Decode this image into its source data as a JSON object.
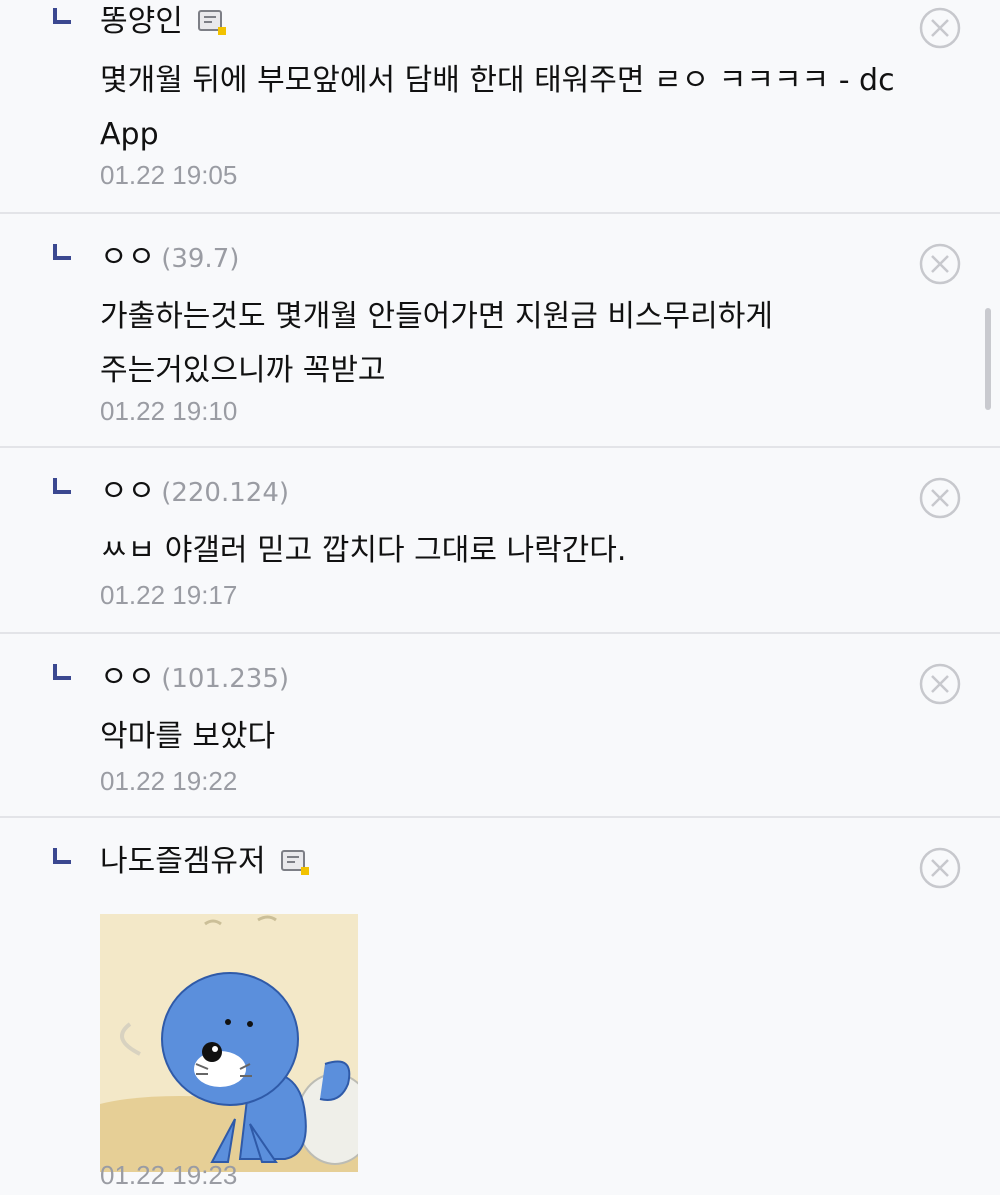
{
  "replies": [
    {
      "author": "똥양인",
      "ip": "",
      "has_fixed_icon": true,
      "content": "몇개월 뒤에 부모앞에서 담배 한대 태워주면 ㄹㅇ ㅋㅋㅋㅋ - dc App",
      "date": "01.22 19:05"
    },
    {
      "author": "ㅇㅇ",
      "ip": "(39.7)",
      "has_fixed_icon": false,
      "content": "가출하는것도 몇개월 안들어가면 지원금 비스무리하게 주는거있으니까 꼭받고",
      "date": "01.22 19:10"
    },
    {
      "author": "ㅇㅇ",
      "ip": "(220.124)",
      "has_fixed_icon": false,
      "content": "ㅆㅂ 야갤러 믿고 깝치다 그대로 나락간다.",
      "date": "01.22 19:17"
    },
    {
      "author": "ㅇㅇ",
      "ip": "(101.235)",
      "has_fixed_icon": false,
      "content": "악마를 보았다",
      "date": "01.22 19:22"
    },
    {
      "author": "나도즐겜유저",
      "ip": "",
      "has_fixed_icon": true,
      "sticker": "blue-seal-character-sticker",
      "date": "01.22 19:23"
    }
  ],
  "icons": {
    "reply_arrow": "reply-arrow-icon",
    "delete": "delete-circle-x-icon",
    "fixed_nick": "fixed-nick-badge-icon"
  },
  "colors": {
    "background": "#f8f9fb",
    "divider": "#e3e4e8",
    "muted_text": "#9a9ca3",
    "reply_arrow": "#3b4890",
    "sticker_blue": "#5b8fdc"
  }
}
